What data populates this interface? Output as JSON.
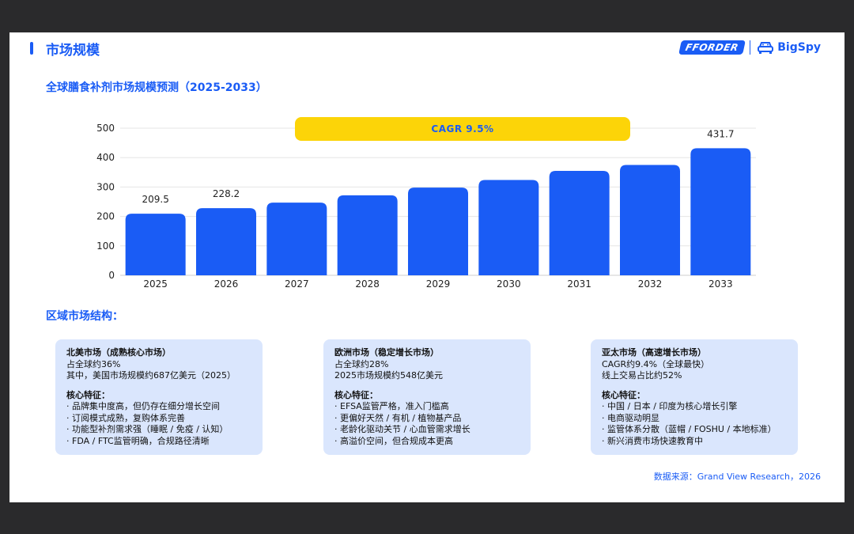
{
  "page_title": "市场规模",
  "logos": {
    "ff": "FFORDER",
    "bigspy": "BigSpy"
  },
  "chart_title": "全球膳食补剂市场规模预测（2025-2033）",
  "cagr_label": "CAGR   9.5%",
  "chart_data": {
    "type": "bar",
    "title": "全球膳食补剂市场规模预测（2025-2033）",
    "categories": [
      "2025",
      "2026",
      "2027",
      "2028",
      "2029",
      "2030",
      "2031",
      "2032",
      "2033"
    ],
    "values": [
      209.5,
      228.2,
      247,
      272,
      298,
      324,
      355,
      375,
      431.7
    ],
    "data_labels": [
      "209.5",
      "228.2",
      "",
      "",
      "",
      "",
      "",
      "",
      "431.7"
    ],
    "ylim": [
      0,
      500
    ],
    "yticks": [
      0,
      100,
      200,
      300,
      400,
      500
    ],
    "grid": true,
    "color": "#1a5cf5"
  },
  "region_title": "区域市场结构：",
  "regions": [
    {
      "heading": "北美市场（成熟核心市场）",
      "lines": [
        "占全球约36%",
        "其中，美国市场规模约687亿美元（2025）"
      ],
      "feature_heading": "核心特征：",
      "features": [
        "· 品牌集中度高，但仍存在细分增长空间",
        "· 订阅模式成熟，复购体系完善",
        "· 功能型补剂需求强（睡眠 / 免疫 / 认知）",
        "· FDA / FTC监管明确，合规路径清晰"
      ]
    },
    {
      "heading": "欧洲市场（稳定增长市场）",
      "lines": [
        "占全球约28%",
        "2025市场规模约548亿美元"
      ],
      "feature_heading": "核心特征：",
      "features": [
        "· EFSA监管严格，准入门槛高",
        "· 更偏好天然 / 有机 / 植物基产品",
        "· 老龄化驱动关节 / 心血管需求增长",
        "· 高溢价空间，但合规成本更高"
      ]
    },
    {
      "heading": "亚太市场（高速增长市场）",
      "lines": [
        "CAGR约9.4%（全球最快）",
        "线上交易占比约52%"
      ],
      "feature_heading": "核心特征：",
      "features": [
        "· 中国 / 日本 / 印度为核心增长引擎",
        "· 电商驱动明显",
        "· 监管体系分散（蓝帽 / FOSHU / 本地标准）",
        "· 新兴消费市场快速教育中"
      ]
    }
  ],
  "source": "数据来源：Grand View Research，2026"
}
